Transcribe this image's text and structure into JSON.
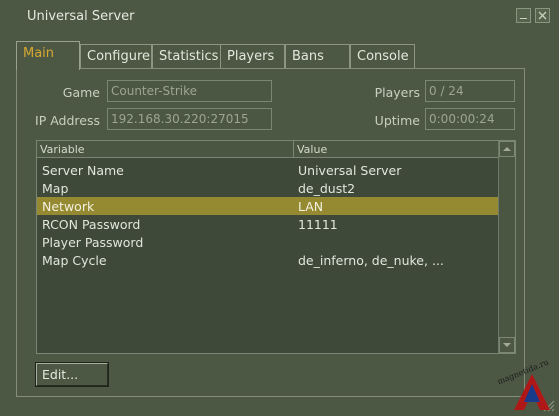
{
  "window": {
    "title": "Universal Server"
  },
  "tabs": [
    {
      "label": "Main",
      "active": true
    },
    {
      "label": "Configure",
      "active": false
    },
    {
      "label": "Statistics",
      "active": false
    },
    {
      "label": "Players",
      "active": false
    },
    {
      "label": "Bans",
      "active": false
    },
    {
      "label": "Console",
      "active": false
    }
  ],
  "info": {
    "game_label": "Game",
    "game_value": "Counter-Strike",
    "ip_label": "IP Address",
    "ip_value": "192.168.30.220:27015",
    "players_label": "Players",
    "players_value": "0 / 24",
    "uptime_label": "Uptime",
    "uptime_value": "0:00:00:24"
  },
  "table": {
    "columns": [
      "Variable",
      "Value"
    ],
    "rows": [
      {
        "variable": "Server Name",
        "value": "Universal Server",
        "selected": false
      },
      {
        "variable": "Map",
        "value": "de_dust2",
        "selected": false
      },
      {
        "variable": "Network",
        "value": "LAN",
        "selected": true
      },
      {
        "variable": "RCON Password",
        "value": "11111",
        "selected": false
      },
      {
        "variable": "Player Password",
        "value": "",
        "selected": false
      },
      {
        "variable": "Map Cycle",
        "value": "de_inferno, de_nuke, ...",
        "selected": false
      }
    ]
  },
  "actions": {
    "edit_label": "Edit..."
  },
  "watermark": {
    "text": "magnetida.ru"
  },
  "colors": {
    "window_bg": "#4c5844",
    "selection": "#958a32",
    "active_tab_text": "#d6a830"
  }
}
